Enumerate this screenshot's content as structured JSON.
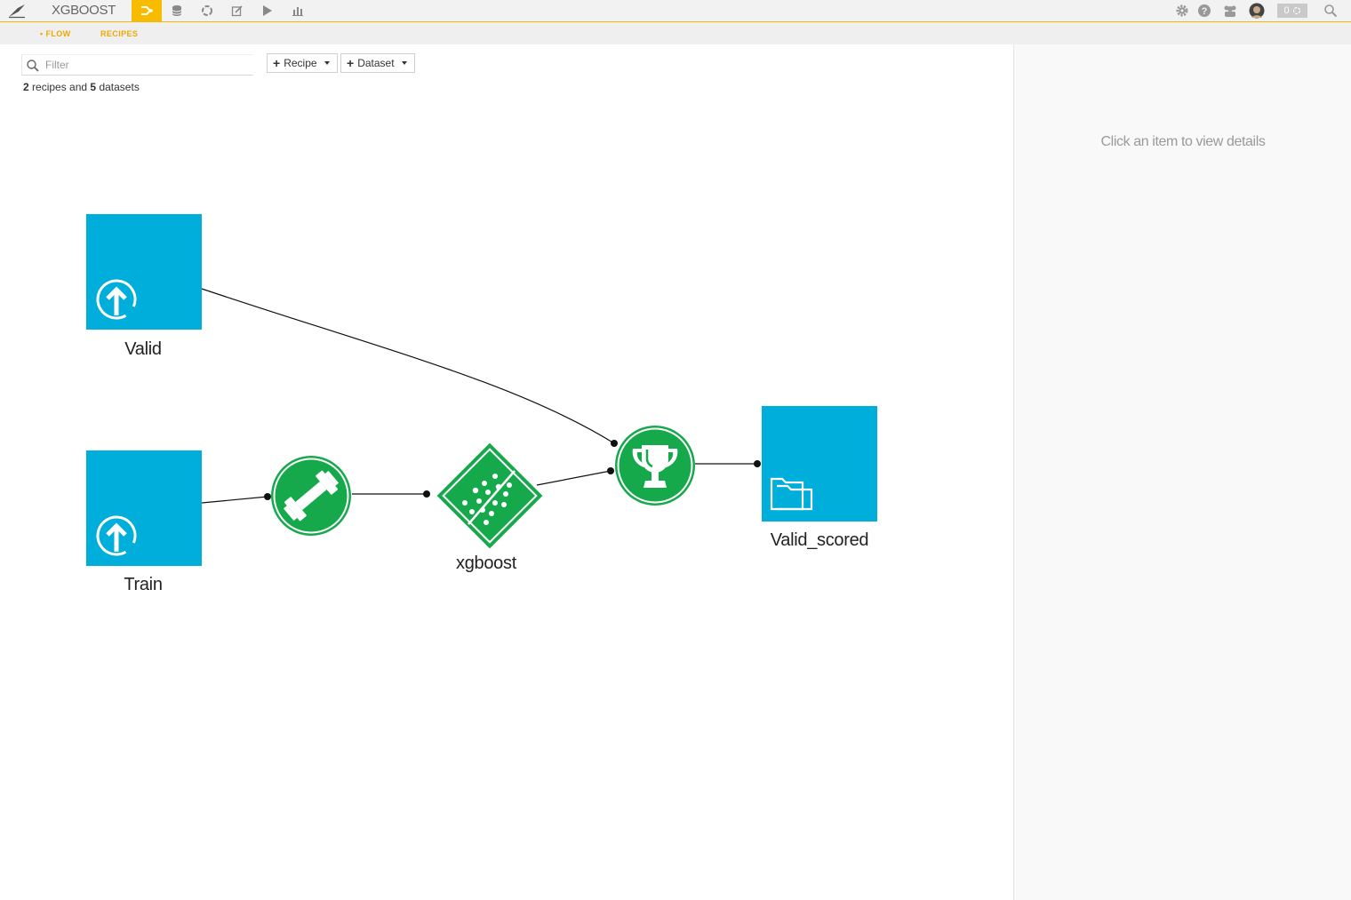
{
  "app": {
    "project_name": "XGBOOST",
    "counter": "0"
  },
  "topbar_icons": [
    "flow-icon",
    "datasets-icon",
    "recipes-icon",
    "notebooks-icon",
    "jobs-icon",
    "dashboards-icon"
  ],
  "subtabs": [
    {
      "label": "• FLOW",
      "active": true
    },
    {
      "label": "RECIPES",
      "active": false
    }
  ],
  "toolbar": {
    "filter_placeholder": "Filter",
    "recipe_button": "Recipe",
    "dataset_button": "Dataset"
  },
  "summary": {
    "recipes_count": "2",
    "recipes_text": "recipes and",
    "datasets_count": "5",
    "datasets_text": "datasets"
  },
  "details_panel": {
    "hint": "Click an item to view details"
  },
  "flow": {
    "datasets": [
      {
        "name": "Valid",
        "icon": "upload-icon"
      },
      {
        "name": "Train",
        "icon": "upload-icon"
      },
      {
        "name": "Valid_scored",
        "icon": "folder-icon"
      }
    ],
    "recipes": [
      {
        "name": "",
        "icon": "train-dumbbell-icon"
      },
      {
        "name": "",
        "icon": "score-trophy-icon"
      }
    ],
    "model": {
      "name": "xgboost",
      "icon": "scatter-model-icon"
    }
  },
  "colors": {
    "accent": "#f7bc00",
    "dataset": "#00aedb",
    "recipe": "#16a94b"
  }
}
